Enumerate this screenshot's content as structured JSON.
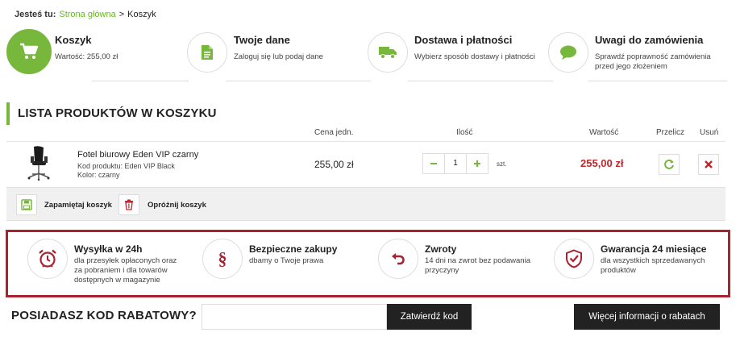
{
  "breadcrumb": {
    "prefix": "Jesteś tu:",
    "home": "Strona główna",
    "separator": ">",
    "current": "Koszyk"
  },
  "steps": [
    {
      "title": "Koszyk",
      "subtitle": "Wartość: 255,00 zł",
      "icon": "cart-icon",
      "active": true
    },
    {
      "title": "Twoje dane",
      "subtitle": "Zaloguj się lub podaj dane",
      "icon": "document-icon",
      "active": false
    },
    {
      "title": "Dostawa i płatności",
      "subtitle": "Wybierz sposób dostawy i płatności",
      "icon": "truck-icon",
      "active": false
    },
    {
      "title": "Uwagi do zamówienia",
      "subtitle_line1": "Sprawdź poprawność zamówienia",
      "subtitle_line2": "przed jego złożeniem",
      "icon": "speech-bubble-icon",
      "active": false
    }
  ],
  "section_title": "LISTA PRODUKTÓW W KOSZYKU",
  "table_headers": {
    "unit_price": "Cena jedn.",
    "quantity": "Ilość",
    "value": "Wartość",
    "recalculate": "Przelicz",
    "remove": "Usuń"
  },
  "product": {
    "name": "Fotel biurowy Eden VIP czarny",
    "code": "Kod produktu: Eden VIP Black",
    "color": "Kolor: czarny",
    "unit_price": "255,00 zł",
    "quantity": "1",
    "unit": "szt.",
    "total": "255,00 zł"
  },
  "cart_actions": {
    "save": "Zapamiętaj koszyk",
    "empty": "Opróżnij koszyk"
  },
  "benefits": [
    {
      "title": "Wysyłka w 24h",
      "lines": [
        "dla przesyłek opłaconych oraz",
        "za pobraniem i dla towarów",
        "dostępnych w magazynie"
      ],
      "icon": "alarm-clock-icon"
    },
    {
      "title": "Bezpieczne zakupy",
      "lines": [
        "dbamy o Twoje prawa"
      ],
      "icon": "section-sign-icon"
    },
    {
      "title": "Zwroty",
      "lines": [
        "14 dni na zwrot bez podawania",
        "przyczyny"
      ],
      "icon": "return-arrow-icon"
    },
    {
      "title": "Gwarancja 24 miesiące",
      "lines": [
        "dla wszystkich sprzedawanych",
        "produktów"
      ],
      "icon": "shield-check-icon"
    }
  ],
  "discount": {
    "title": "POSIADASZ KOD RABATOWY?",
    "input_value": "",
    "submit": "Zatwierdź kod",
    "more_info": "Więcej informacji o rabatach"
  },
  "colors": {
    "accent_green": "#77b73b",
    "price_red": "#c1272d",
    "benefit_border": "#a82330",
    "button_dark": "#222222"
  }
}
